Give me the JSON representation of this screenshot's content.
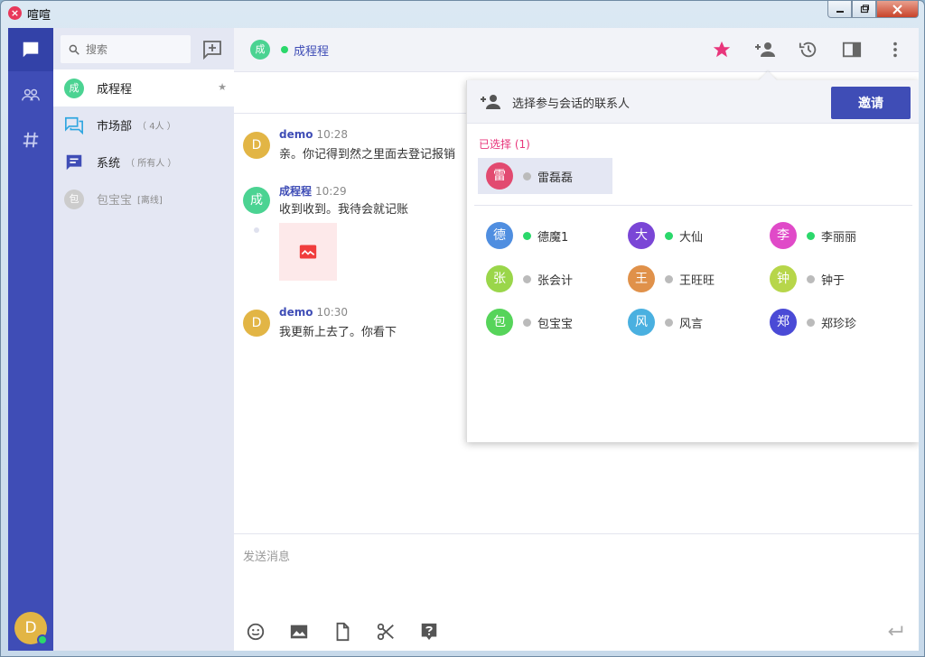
{
  "window": {
    "title": "喧喧",
    "app_logo": "×"
  },
  "rail": {
    "items": [
      {
        "name": "chat-bubble-icon",
        "active": true
      },
      {
        "name": "contacts-icon",
        "active": false
      },
      {
        "name": "hashtag-icon",
        "active": false
      }
    ],
    "user_avatar": "D"
  },
  "list": {
    "search_placeholder": "搜索",
    "conversations": [
      {
        "avatar": "成",
        "label": "成程程",
        "sub": "",
        "color": "#4bd392"
      },
      {
        "avatar": "",
        "label": "市场部",
        "sub": "（ 4人 ）",
        "color": "#2fa6e0"
      },
      {
        "avatar": "",
        "label": "系统",
        "sub": "（ 所有人 ）",
        "color": "#3f4db6"
      },
      {
        "avatar": "包",
        "label": "包宝宝",
        "sub": "[离线]",
        "color": "#cccccc"
      }
    ]
  },
  "chat": {
    "header": {
      "avatar": "成",
      "name": "成程程"
    },
    "messages": [
      {
        "avatar": "D",
        "author": "demo",
        "time": "10:28",
        "text": "亲。你记得到然之里面去登记报销",
        "color": "#e2b545"
      },
      {
        "avatar": "成",
        "author": "成程程",
        "time": "10:29",
        "text": "收到收到。我待会就记账",
        "color": "#4bd392"
      },
      {
        "avatar": "D",
        "author": "demo",
        "time": "10:30",
        "text": "我更新上去了。你看下",
        "color": "#e2b545"
      }
    ],
    "composer_placeholder": "发送消息"
  },
  "invite": {
    "title": "选择参与会话的联系人",
    "button": "邀请",
    "selected_label": "已选择 (1)",
    "selected": {
      "avatar": "雷",
      "name": "雷磊磊",
      "color": "#e24a70",
      "online": false
    },
    "contacts": [
      {
        "avatar": "德",
        "name": "德魔1",
        "color": "#4f8ee0",
        "online": true
      },
      {
        "avatar": "大",
        "name": "大仙",
        "color": "#7a46d6",
        "online": true
      },
      {
        "avatar": "李",
        "name": "李丽丽",
        "color": "#e04ac8",
        "online": true
      },
      {
        "avatar": "张",
        "name": "张会计",
        "color": "#9ad64a",
        "online": false
      },
      {
        "avatar": "王",
        "name": "王旺旺",
        "color": "#e0914a",
        "online": false
      },
      {
        "avatar": "钟",
        "name": "钟于",
        "color": "#b7d64a",
        "online": false
      },
      {
        "avatar": "包",
        "name": "包宝宝",
        "color": "#56d45a",
        "online": false
      },
      {
        "avatar": "风",
        "name": "风言",
        "color": "#4ab0e0",
        "online": false
      },
      {
        "avatar": "郑",
        "name": "郑珍珍",
        "color": "#4a4ad6",
        "online": false
      }
    ]
  },
  "colors": {
    "accent": "#3f4db6",
    "online": "#2bd86b",
    "offline": "#bbbbbb",
    "star": "#e8357b"
  }
}
